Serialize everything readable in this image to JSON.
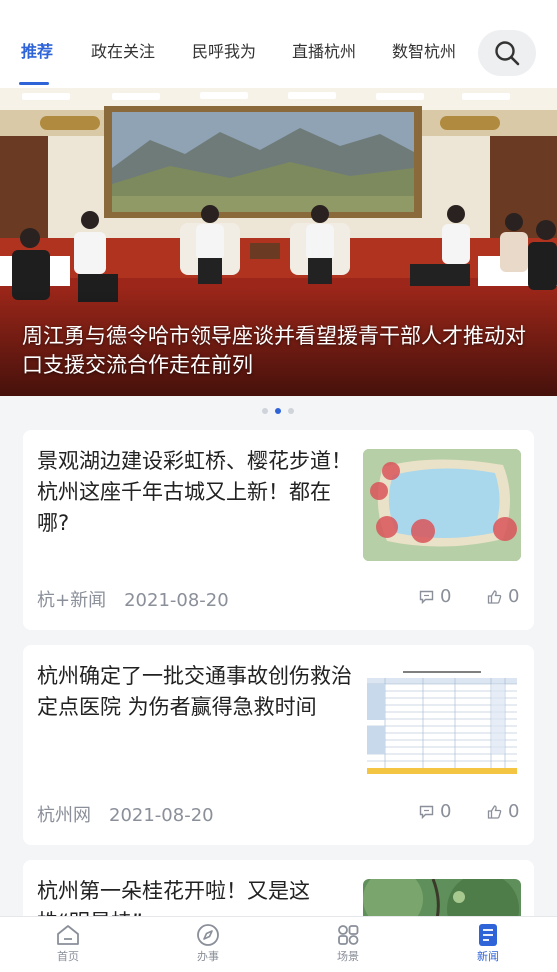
{
  "tabs": [
    {
      "label": "推荐",
      "active": true
    },
    {
      "label": "政在关注",
      "active": false
    },
    {
      "label": "民呼我为",
      "active": false
    },
    {
      "label": "直播杭州",
      "active": false
    },
    {
      "label": "数智杭州",
      "active": false
    }
  ],
  "search": {
    "icon": "search-icon"
  },
  "banner": {
    "caption": "周江勇与德令哈市领导座谈并看望援青干部人才推动对口支援交流合作走在前列",
    "slide_count": 3,
    "active_slide": 2
  },
  "articles": [
    {
      "title": "景观湖边建设彩虹桥、樱花步道！杭州这座千年古城又上新！都在哪?",
      "source": "杭+新闻",
      "date": "2021-08-20",
      "comments": "0",
      "likes": "0",
      "thumb": "map"
    },
    {
      "title": "杭州确定了一批交通事故创伤救治定点医院 为伤者赢得急救时间",
      "source": "杭州网",
      "date": "2021-08-20",
      "comments": "0",
      "likes": "0",
      "thumb": "table"
    },
    {
      "title": "杭州第一朵桂花开啦！又是这株“明星桂”",
      "thumb": "osmanthus"
    }
  ],
  "bottom_nav": [
    {
      "label": "首页",
      "icon": "home-icon",
      "active": false
    },
    {
      "label": "办事",
      "icon": "compass-icon",
      "active": false
    },
    {
      "label": "场景",
      "icon": "grid-icon",
      "active": false
    },
    {
      "label": "新闻",
      "icon": "news-icon",
      "active": true
    }
  ],
  "colors": {
    "accent": "#2f64d8",
    "muted": "#8a8f99",
    "background": "#f4f5f7"
  }
}
